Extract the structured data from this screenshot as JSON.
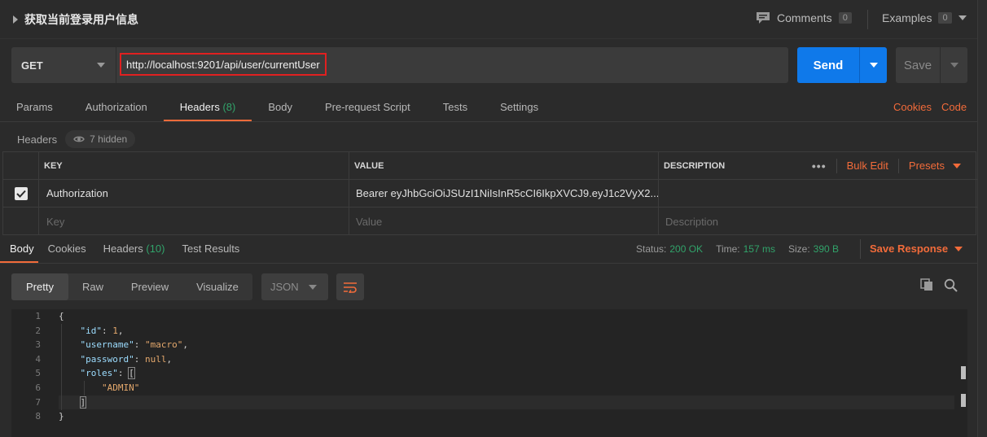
{
  "request": {
    "title": "获取当前登录用户信息",
    "method": "GET",
    "url": "http://localhost:9201/api/user/currentUser"
  },
  "topbar": {
    "comments_label": "Comments",
    "comments_count": "0",
    "examples_label": "Examples",
    "examples_count": "0"
  },
  "buttons": {
    "send": "Send",
    "save": "Save"
  },
  "request_tabs": [
    {
      "label": "Params",
      "count": ""
    },
    {
      "label": "Authorization",
      "count": ""
    },
    {
      "label": "Headers",
      "count": "(8)"
    },
    {
      "label": "Body",
      "count": ""
    },
    {
      "label": "Pre-request Script",
      "count": ""
    },
    {
      "label": "Tests",
      "count": ""
    },
    {
      "label": "Settings",
      "count": ""
    }
  ],
  "request_links": {
    "cookies": "Cookies",
    "code": "Code"
  },
  "headers_section": {
    "label": "Headers",
    "hidden": "7 hidden",
    "columns": {
      "key": "KEY",
      "value": "VALUE",
      "description": "DESCRIPTION"
    },
    "bulk_edit": "Bulk Edit",
    "presets": "Presets",
    "rows": [
      {
        "key": "Authorization",
        "value": "Bearer eyJhbGciOiJSUzI1NiIsInR5cCI6IkpXVCJ9.eyJ1c2VyX2...",
        "description": ""
      }
    ],
    "placeholders": {
      "key": "Key",
      "value": "Value",
      "description": "Description"
    }
  },
  "response_tabs": [
    {
      "label": "Body",
      "count": ""
    },
    {
      "label": "Cookies",
      "count": ""
    },
    {
      "label": "Headers",
      "count": "(10)"
    },
    {
      "label": "Test Results",
      "count": ""
    }
  ],
  "status": {
    "status_label": "Status:",
    "status_value": "200 OK",
    "time_label": "Time:",
    "time_value": "157 ms",
    "size_label": "Size:",
    "size_value": "390 B",
    "save_response": "Save Response"
  },
  "viewer": {
    "modes": [
      "Pretty",
      "Raw",
      "Preview",
      "Visualize"
    ],
    "language": "JSON"
  },
  "code_lines": [
    "1",
    "2",
    "3",
    "4",
    "5",
    "6",
    "7",
    "8"
  ],
  "json_body": {
    "open_brace": "{",
    "id_key": "\"id\"",
    "id_val": "1",
    "username_key": "\"username\"",
    "username_val": "\"macro\"",
    "password_key": "\"password\"",
    "password_val": "null",
    "roles_key": "\"roles\"",
    "open_bracket": "[",
    "role_item": "\"ADMIN\"",
    "close_bracket": "]",
    "close_brace": "}"
  },
  "colors": {
    "accent": "#f26b3a",
    "send_blue": "#0f79ea",
    "success_green": "#31a36a",
    "url_highlight": "#e02020"
  }
}
